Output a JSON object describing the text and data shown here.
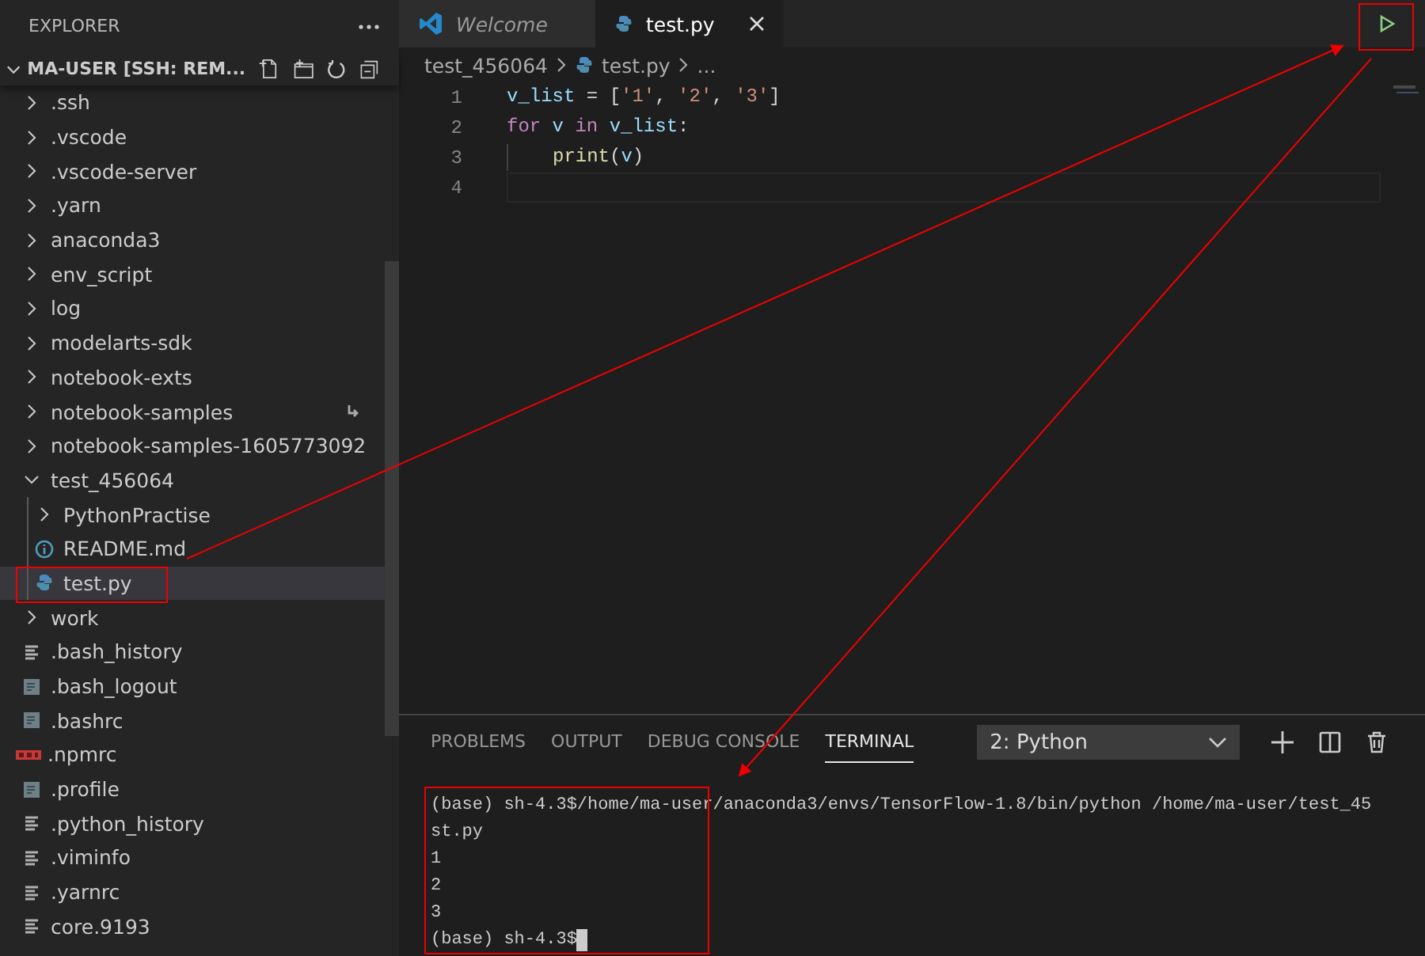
{
  "explorer": {
    "title": "EXPLORER",
    "section": {
      "title": "MA-USER [SSH: REM...",
      "expanded": true
    },
    "items": [
      {
        "kind": "folder",
        "name": ".ssh",
        "expanded": false,
        "selected": false
      },
      {
        "kind": "folder",
        "name": ".vscode",
        "expanded": false,
        "selected": false
      },
      {
        "kind": "folder",
        "name": ".vscode-server",
        "expanded": false,
        "selected": false
      },
      {
        "kind": "folder",
        "name": ".yarn",
        "expanded": false,
        "selected": false
      },
      {
        "kind": "folder",
        "name": "anaconda3",
        "expanded": false,
        "selected": false
      },
      {
        "kind": "folder",
        "name": "env_script",
        "expanded": false,
        "selected": false
      },
      {
        "kind": "folder",
        "name": "log",
        "expanded": false,
        "selected": false
      },
      {
        "kind": "folder",
        "name": "modelarts-sdk",
        "expanded": false,
        "selected": false
      },
      {
        "kind": "folder",
        "name": "notebook-exts",
        "expanded": false,
        "selected": false
      },
      {
        "kind": "folder",
        "name": "notebook-samples",
        "expanded": false,
        "selected": false,
        "symlink": true
      },
      {
        "kind": "folder",
        "name": "notebook-samples-1605773092",
        "expanded": false,
        "selected": false
      },
      {
        "kind": "folder",
        "name": "test_456064",
        "expanded": true,
        "selected": false,
        "children": [
          {
            "kind": "folder",
            "name": "PythonPractise",
            "expanded": false,
            "selected": false
          },
          {
            "kind": "info",
            "name": "README.md",
            "selected": false
          },
          {
            "kind": "python",
            "name": "test.py",
            "selected": true
          }
        ]
      },
      {
        "kind": "folder",
        "name": "work",
        "expanded": false,
        "selected": false
      },
      {
        "kind": "lines",
        "name": ".bash_history",
        "selected": false
      },
      {
        "kind": "doc",
        "name": ".bash_logout",
        "selected": false
      },
      {
        "kind": "doc",
        "name": ".bashrc",
        "selected": false
      },
      {
        "kind": "npm",
        "name": ".npmrc",
        "selected": false
      },
      {
        "kind": "doc",
        "name": ".profile",
        "selected": false
      },
      {
        "kind": "lines",
        "name": ".python_history",
        "selected": false
      },
      {
        "kind": "lines",
        "name": ".viminfo",
        "selected": false
      },
      {
        "kind": "lines",
        "name": ".yarnrc",
        "selected": false
      },
      {
        "kind": "lines",
        "name": "core.9193",
        "selected": false
      }
    ]
  },
  "tabs": [
    {
      "label": "Welcome",
      "kind": "welcome",
      "selected": false
    },
    {
      "label": "test.py",
      "kind": "python",
      "selected": true
    }
  ],
  "breadcrumbs": [
    {
      "label": "test_456064",
      "kind": "folder"
    },
    {
      "label": "test.py",
      "kind": "python"
    },
    {
      "label": "...",
      "kind": "more"
    }
  ],
  "code_lines": [
    {
      "number": "1",
      "current": false,
      "indented": false,
      "tokens": [
        {
          "text": "v_list",
          "kind": "var"
        },
        {
          "text": " = [",
          "kind": "punct"
        },
        {
          "text": "'1'",
          "kind": "str"
        },
        {
          "text": ", ",
          "kind": "punct"
        },
        {
          "text": "'2'",
          "kind": "str"
        },
        {
          "text": ", ",
          "kind": "punct"
        },
        {
          "text": "'3'",
          "kind": "str"
        },
        {
          "text": "]",
          "kind": "punct"
        }
      ]
    },
    {
      "number": "2",
      "current": false,
      "indented": false,
      "tokens": [
        {
          "text": "for",
          "kind": "kw"
        },
        {
          "text": " v ",
          "kind": "var"
        },
        {
          "text": "in",
          "kind": "kw"
        },
        {
          "text": " v_list",
          "kind": "var"
        },
        {
          "text": ":",
          "kind": "punct"
        }
      ]
    },
    {
      "number": "3",
      "current": false,
      "indented": true,
      "tokens": [
        {
          "text": "print",
          "kind": "fn"
        },
        {
          "text": "(",
          "kind": "punct"
        },
        {
          "text": "v",
          "kind": "var"
        },
        {
          "text": ")",
          "kind": "punct"
        }
      ]
    },
    {
      "number": "4",
      "current": true,
      "indented": false
    }
  ],
  "panel": {
    "tabs": [
      {
        "label": "PROBLEMS",
        "selected": false
      },
      {
        "label": "OUTPUT",
        "selected": false
      },
      {
        "label": "DEBUG CONSOLE",
        "selected": false
      },
      {
        "label": "TERMINAL",
        "selected": true
      }
    ],
    "terminal_select": "2: Python",
    "terminal_lines": [
      "(base) sh-4.3$/home/ma-user/anaconda3/envs/TensorFlow-1.8/bin/python /home/ma-user/test_45",
      "st.py",
      "1",
      "2",
      "3",
      "(base) sh-4.3$"
    ]
  }
}
